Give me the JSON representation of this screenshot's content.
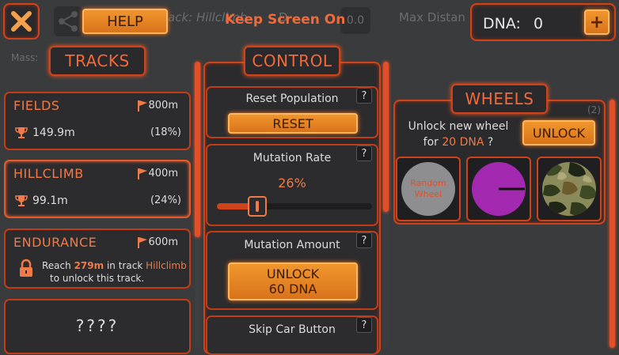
{
  "background": {
    "track_text": "ack: Hillclimb",
    "dist_text": "D",
    "dist_value": "0.0",
    "max_distance": "Max Distan",
    "mass": "Mass:"
  },
  "header": {
    "help_label": "HELP",
    "keep_screen_on": "Keep Screen On",
    "dna_label": "DNA:",
    "dna_value": "0",
    "add_label": "+"
  },
  "tracks": {
    "title": "TRACKS",
    "items": [
      {
        "name": "FIELDS",
        "distance": "800m",
        "best": "149.9m",
        "percent": "(18%)"
      },
      {
        "name": "HILLCLIMB",
        "distance": "400m",
        "best": "99.1m",
        "percent": "(24%)"
      },
      {
        "name": "ENDURANCE",
        "distance": "600m",
        "lock_text_1": "Reach",
        "lock_value": "279m",
        "lock_text_2": "in track",
        "lock_track": "Hillclimb",
        "lock_text_3": "to unlock this track."
      },
      {
        "name": "????"
      }
    ]
  },
  "control": {
    "title": "CONTROL",
    "reset_population_label": "Reset Population",
    "reset_button": "RESET",
    "mutation_rate_label": "Mutation Rate",
    "mutation_rate_value": "26%",
    "mutation_rate_fraction": 0.26,
    "mutation_amount_label": "Mutation Amount",
    "unlock_line1": "UNLOCK",
    "unlock_line2": "60 DNA",
    "skip_car_label": "Skip Car Button",
    "help_q": "?"
  },
  "wheels": {
    "title": "WHEELS",
    "count": "(2)",
    "unlock_text_1": "Unlock new wheel",
    "unlock_text_2": "for",
    "unlock_cost": "20 DNA",
    "unlock_text_3": "?",
    "unlock_button": "UNLOCK",
    "random_wheel_label": "Random Wheel"
  },
  "colors": {
    "accent": "#f0962e",
    "frame": "#d0431a",
    "highlight": "#f07a48",
    "wheel_purple": "#a32ab0"
  }
}
